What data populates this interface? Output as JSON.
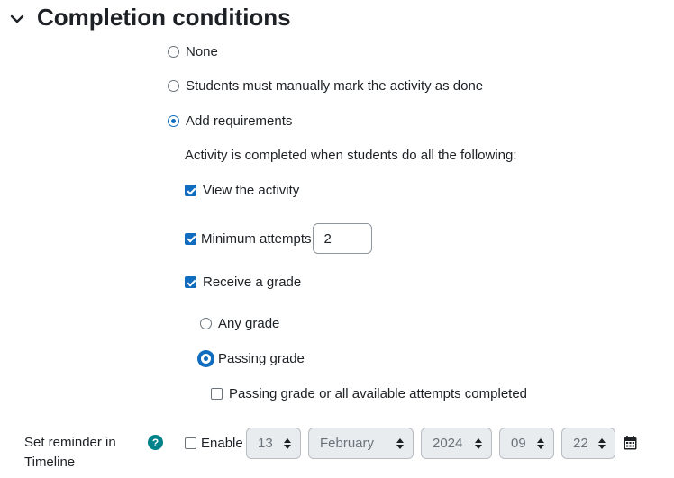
{
  "section": {
    "title": "Completion conditions"
  },
  "options": {
    "none": "None",
    "manual": "Students must manually mark the activity as done",
    "add_requirements": "Add requirements"
  },
  "requirements": {
    "intro": "Activity is completed when students do all the following:",
    "view": "View the activity",
    "min_attempts": "Minimum attempts",
    "min_attempts_value": "2",
    "receive_grade": "Receive a grade",
    "any_grade": "Any grade",
    "passing_grade": "Passing grade",
    "passing_or_attempts": "Passing grade or all available attempts completed"
  },
  "reminder": {
    "label": "Set reminder in Timeline",
    "help": "?",
    "enable": "Enable",
    "day": "13",
    "month": "February",
    "year": "2024",
    "hour": "09",
    "minute": "22"
  },
  "colors": {
    "accent": "#0f6cbf",
    "help": "#00828a",
    "disabled_select": "#e9ecef"
  },
  "icons": [
    "chevron-down-icon",
    "question-icon",
    "updown-icon",
    "calendar-icon"
  ]
}
